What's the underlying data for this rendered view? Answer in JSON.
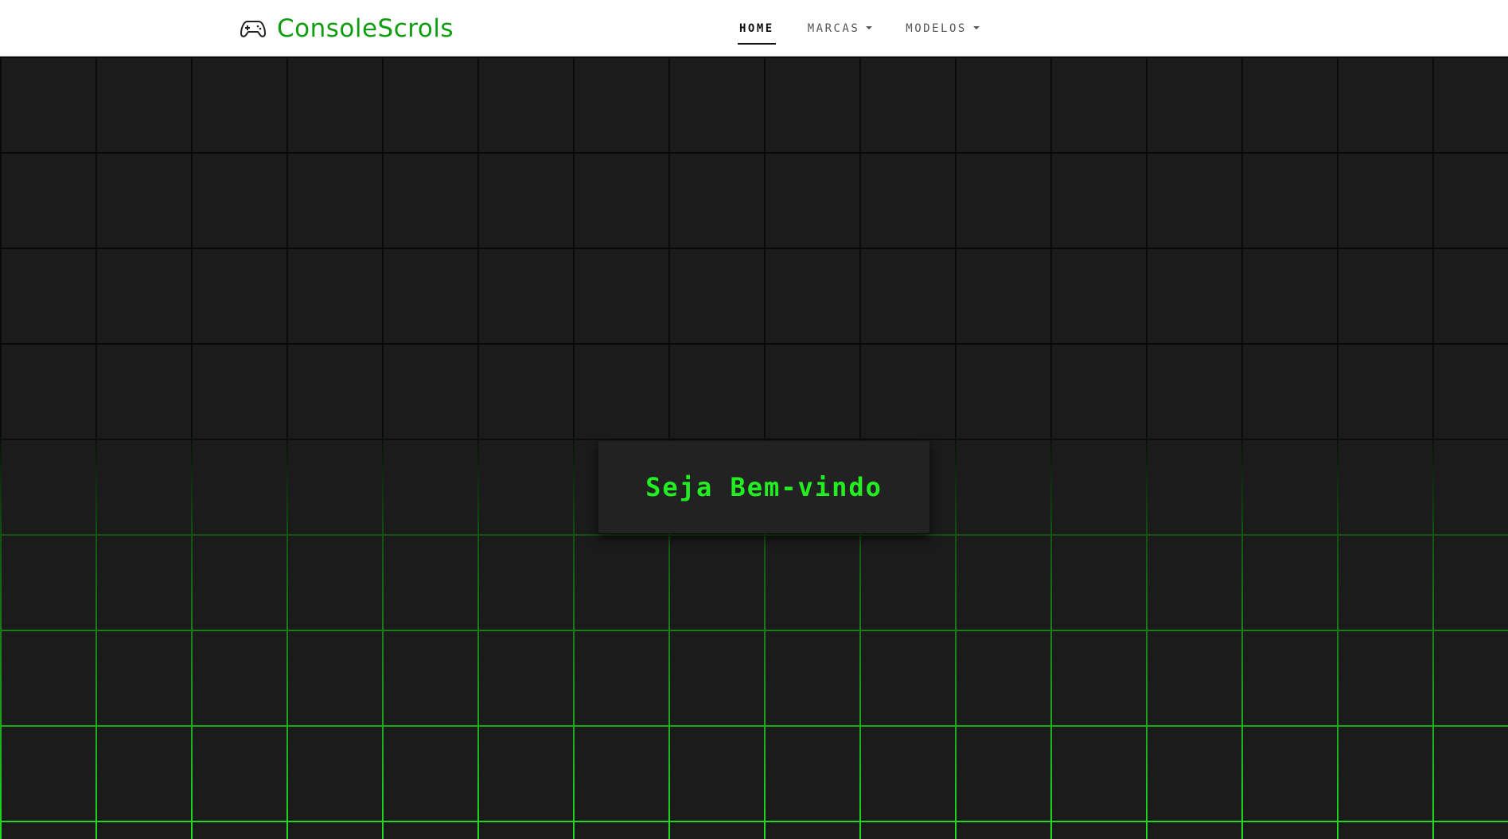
{
  "brand": {
    "name": "ConsoleScrols",
    "icon": "gamepad-icon",
    "color": "#0e9e0e"
  },
  "nav": {
    "items": [
      {
        "label": "HOME",
        "active": true,
        "dropdown": false
      },
      {
        "label": "MARCAS",
        "active": false,
        "dropdown": true
      },
      {
        "label": "MODELOS",
        "active": false,
        "dropdown": true
      }
    ]
  },
  "hero": {
    "welcome": "Seja Bem-vindo",
    "accent_color": "#22ee22",
    "background_color": "#1b1b1b",
    "grid_color": "#22dd22"
  }
}
